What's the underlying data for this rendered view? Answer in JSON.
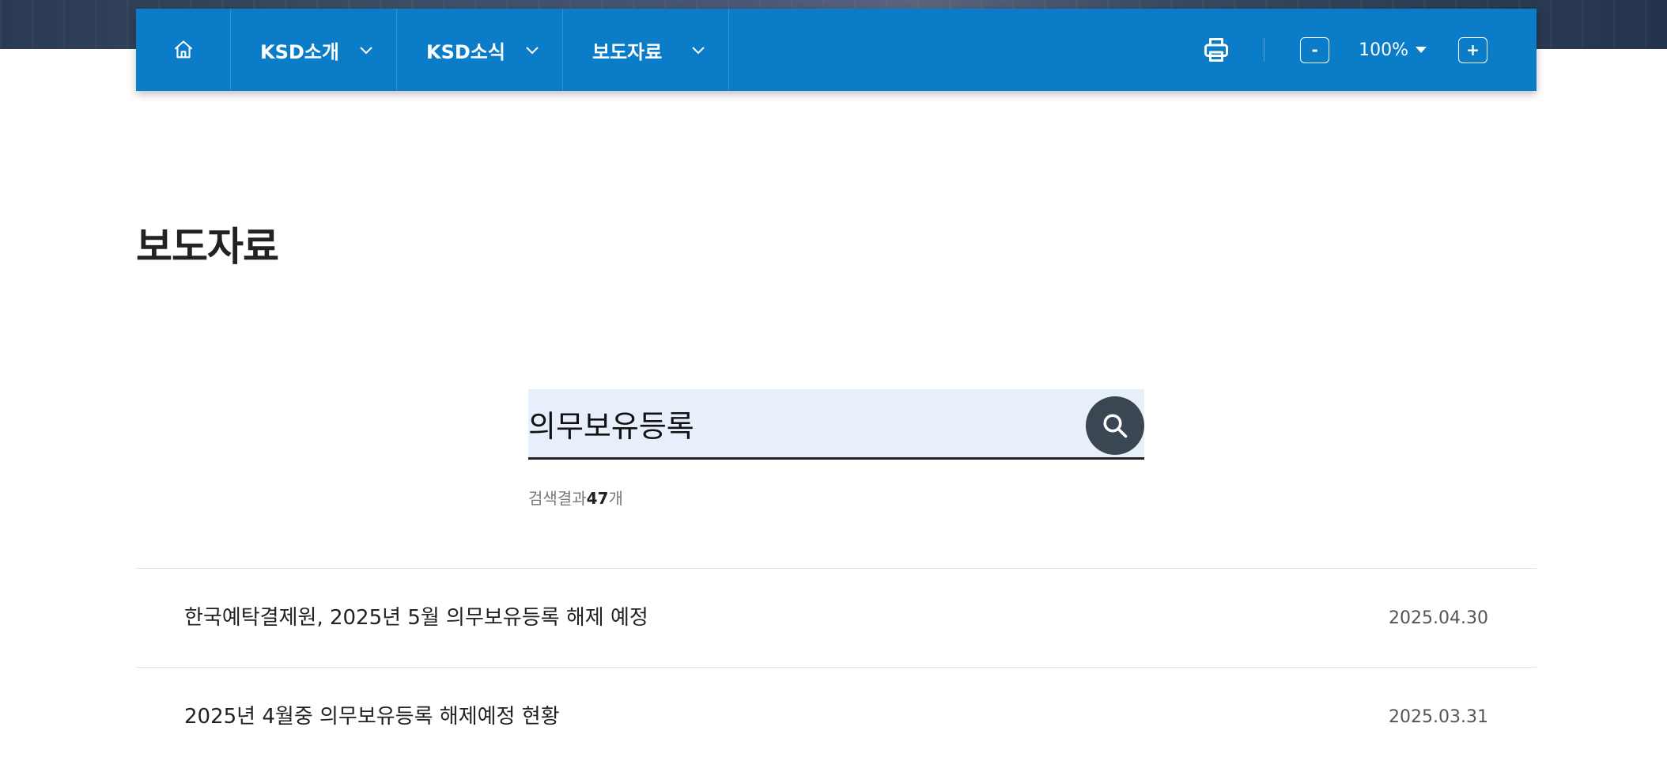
{
  "nav": {
    "home_icon": "home-icon",
    "menus": [
      {
        "label": "KSD소개"
      },
      {
        "label": "KSD소식"
      },
      {
        "label": "보도자료"
      }
    ],
    "print_icon": "printer-icon",
    "zoom_out_label": "-",
    "zoom_level": "100%",
    "zoom_in_label": "+"
  },
  "page": {
    "title": "보도자료"
  },
  "search": {
    "value": "의무보유등록",
    "button_icon": "search-icon"
  },
  "results": {
    "prefix": "검색결과",
    "count": "47",
    "suffix": "개"
  },
  "list": [
    {
      "title": "한국예탁결제원, 2025년 5월 의무보유등록 해제 예정",
      "date": "2025.04.30"
    },
    {
      "title": "2025년 4월중 의무보유등록 해제예정 현황",
      "date": "2025.03.31"
    }
  ],
  "colors": {
    "nav_bg": "#0a7cc8",
    "search_bg": "#e7effb",
    "search_btn": "#3a4651"
  }
}
